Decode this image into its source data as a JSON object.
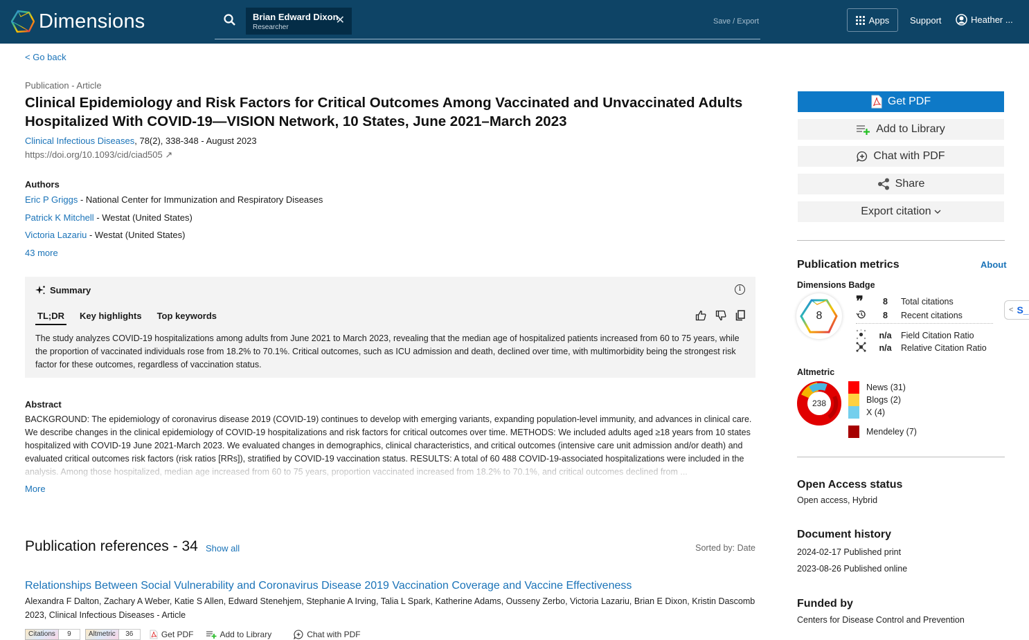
{
  "header": {
    "app_name": "Dimensions",
    "search_chip": {
      "name": "Brian Edward Dixon",
      "role": "Researcher"
    },
    "save_export": "Save / Export",
    "apps_label": "Apps",
    "support_label": "Support",
    "user_label": "Heather ...",
    "colors": {
      "bar": "#0e4466",
      "chip": "#042d47"
    }
  },
  "nav": {
    "go_back": "< Go back"
  },
  "publication": {
    "type": "Publication - Article",
    "title": "Clinical Epidemiology and Risk Factors for Critical Outcomes Among Vaccinated and Unvaccinated Adults Hospitalized With COVID-19—VISION Network, 10 States, June 2021–March 2023",
    "journal": "Clinical Infectious Diseases",
    "journal_details": ", 78(2), 338-348 - August 2023",
    "doi": "https://doi.org/10.1093/cid/ciad505 ↗"
  },
  "authors": {
    "heading": "Authors",
    "list": [
      {
        "name": "Eric P Griggs",
        "affiliation": " - National Center for Immunization and Respiratory Diseases"
      },
      {
        "name": "Patrick K Mitchell",
        "affiliation": " - Westat (United States)"
      },
      {
        "name": "Victoria Lazariu",
        "affiliation": " - Westat (United States)"
      }
    ],
    "more": "43 more"
  },
  "summary": {
    "heading": "Summary",
    "tabs": [
      {
        "label": "TL;DR",
        "active": true
      },
      {
        "label": "Key highlights",
        "active": false
      },
      {
        "label": "Top keywords",
        "active": false
      }
    ],
    "text": "The study analyzes COVID-19 hospitalizations among adults from June 2021 to March 2023, revealing that the median age of hospitalized patients increased from 60 to 75 years, while the proportion of vaccinated individuals rose from 18.2% to 70.1%. Critical outcomes, such as ICU admission and death, declined over time, with multimorbidity being the strongest risk factor for these outcomes, regardless of vaccination status."
  },
  "abstract": {
    "heading": "Abstract",
    "text": "BACKGROUND: The epidemiology of coronavirus disease 2019 (COVID-19) continues to develop with emerging variants, expanding population-level immunity, and advances in clinical care. We describe changes in the clinical epidemiology of COVID-19 hospitalizations and risk factors for critical outcomes over time. METHODS: We included adults aged ≥18 years from 10 states hospitalized with COVID-19 June 2021-March 2023. We evaluated changes in demographics, clinical characteristics, and critical outcomes (intensive care unit admission and/or death) and evaluated critical outcomes risk factors (risk ratios [RRs]), stratified by COVID-19 vaccination status. RESULTS: A total of 60 488 COVID-19-associated hospitalizations were included in the analysis. Among those hospitalized, median age increased from 60 to 75 years, proportion vaccinated increased from 18.2% to 70.1%, and critical outcomes declined from ...",
    "more": "More"
  },
  "references": {
    "heading": "Publication references - 34",
    "show_all": "Show all",
    "sorted_by": "Sorted by: Date",
    "items": [
      {
        "title": "Relationships Between Social Vulnerability and Coronavirus Disease 2019 Vaccination Coverage and Vaccine Effectiveness",
        "authors": "Alexandra F Dalton, Zachary A Weber, Katie S Allen, Edward Stenehjem, Stephanie A Irving, Talia L Spark, Katherine Adams, Ousseny Zerbo, Victoria Lazariu, Brian E Dixon, Kristin Dascomb",
        "meta": "2023, Clinical Infectious Diseases - Article",
        "citations_label": "Citations",
        "citations": "9",
        "altmetric_label": "Altmetric",
        "altmetric": "36",
        "get_pdf": "Get PDF",
        "add_library": "Add to Library",
        "chat_pdf": "Chat with PDF"
      }
    ]
  },
  "sidebar": {
    "buttons": {
      "get_pdf": "Get PDF",
      "add_library": "Add to Library",
      "chat_pdf": "Chat with PDF",
      "share": "Share",
      "export_citation": "Export citation"
    },
    "metrics": {
      "heading": "Publication metrics",
      "about": "About",
      "badge_heading": "Dimensions Badge",
      "badge_value": "8",
      "rows": [
        {
          "icon": "quote-icon",
          "value": "8",
          "label": "Total citations"
        },
        {
          "icon": "history-icon",
          "value": "8",
          "label": "Recent citations"
        },
        {
          "icon": "field-ratio-icon",
          "value": "n/a",
          "label": "Field Citation Ratio"
        },
        {
          "icon": "relative-ratio-icon",
          "value": "n/a",
          "label": "Relative Citation Ratio"
        }
      ]
    },
    "altmetric": {
      "heading": "Altmetric",
      "score": "238",
      "legend": [
        {
          "label": "News (31)",
          "color": "#ff0000"
        },
        {
          "label": "Blogs (2)",
          "color": "#ffd140"
        },
        {
          "label": "X (4)",
          "color": "#74cfed"
        },
        {
          "label": "Mendeley (7)",
          "color": "#a60000"
        }
      ]
    },
    "open_access": {
      "heading": "Open Access status",
      "value": "Open access, Hybrid"
    },
    "history": {
      "heading": "Document history",
      "items": [
        "2024-02-17 Published print",
        "2023-08-26 Published online"
      ]
    },
    "funded": {
      "heading": "Funded by",
      "value": "Centers for Disease Control and Prevention"
    },
    "side_tab_label": "S_"
  }
}
